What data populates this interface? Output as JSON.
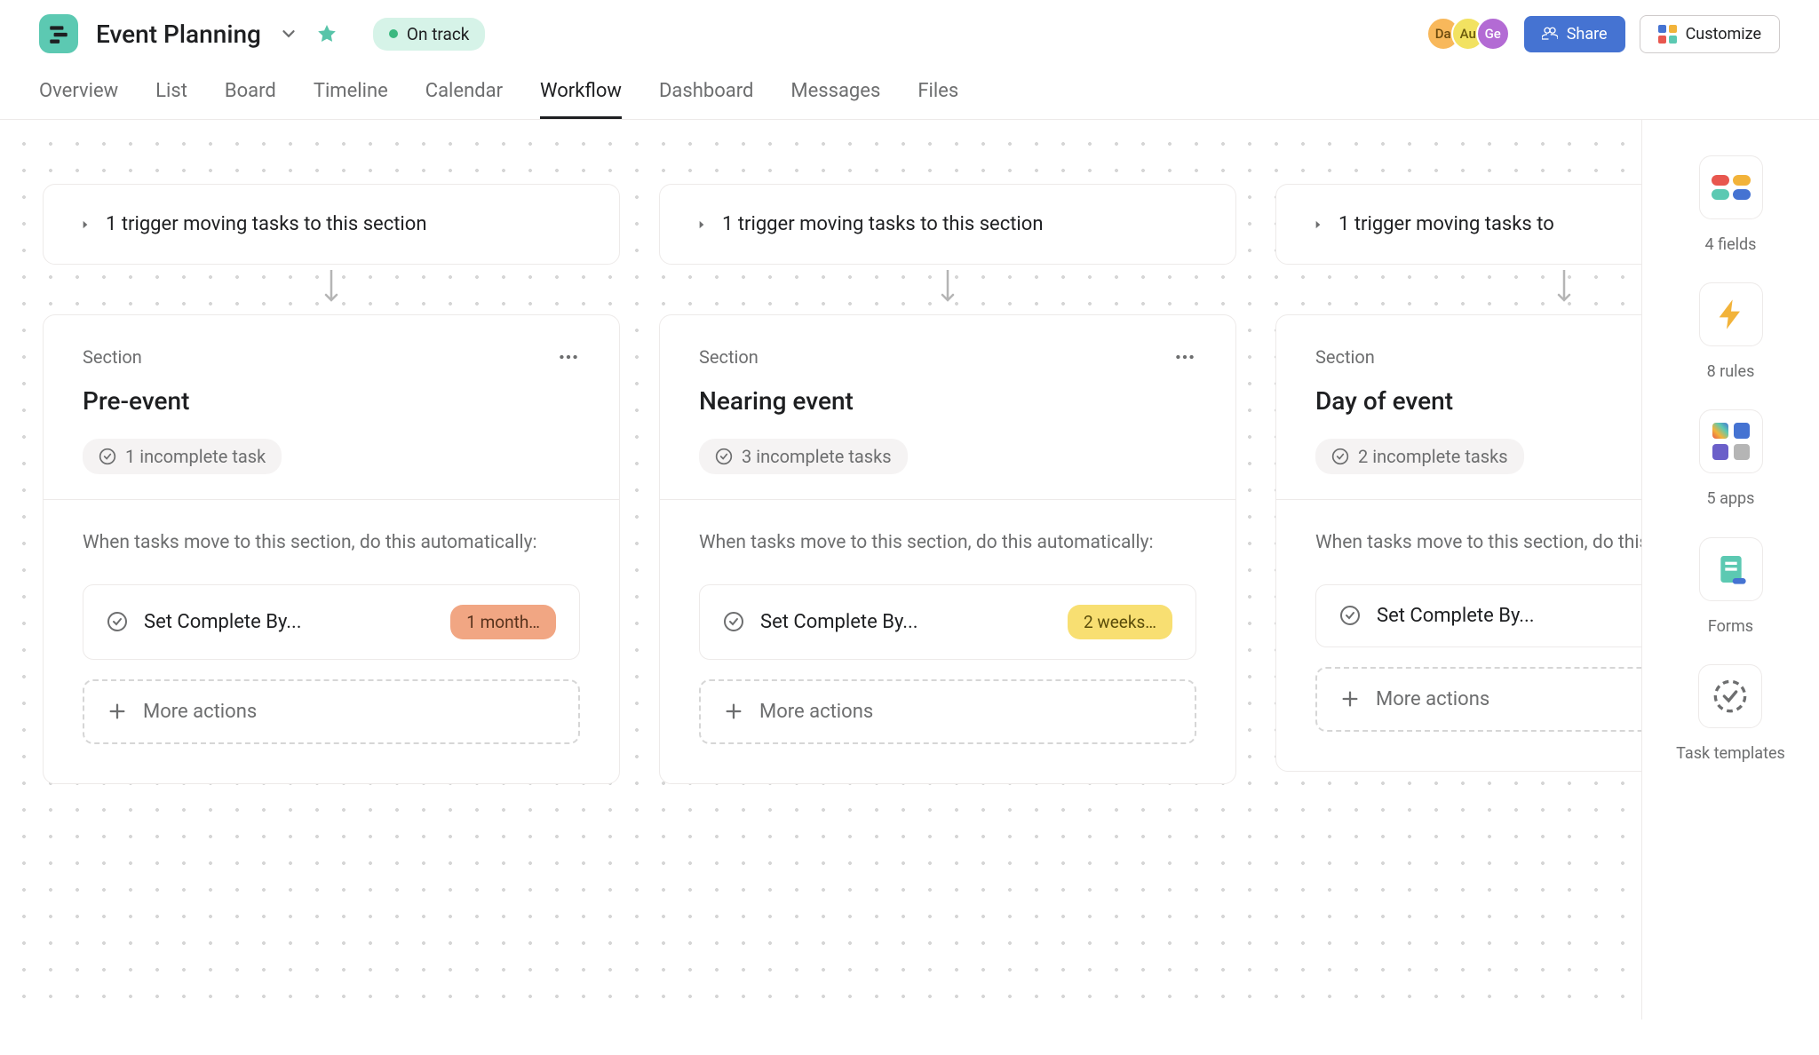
{
  "project": {
    "title": "Event Planning",
    "status": "On track"
  },
  "avatars": [
    {
      "initials": "Da",
      "bg": "#f8b85b",
      "fg": "#6b4a0d"
    },
    {
      "initials": "Au",
      "bg": "#f2e261",
      "fg": "#6b5b0d"
    },
    {
      "initials": "Ge",
      "bg": "#b36bd4",
      "fg": "#ffffff"
    }
  ],
  "buttons": {
    "share": "Share",
    "customize": "Customize"
  },
  "tabs": [
    "Overview",
    "List",
    "Board",
    "Timeline",
    "Calendar",
    "Workflow",
    "Dashboard",
    "Messages",
    "Files"
  ],
  "active_tab": "Workflow",
  "workflow": {
    "section_label": "Section",
    "automation_text": "When tasks move to this section, do this automatically:",
    "more_actions": "More actions",
    "columns": [
      {
        "trigger": "1 trigger moving tasks to this section",
        "title": "Pre-event",
        "tasks": "1 incomplete task",
        "rule": {
          "text": "Set Complete By...",
          "badge": "1 month…",
          "badge_class": "badge-orange"
        }
      },
      {
        "trigger": "1 trigger moving tasks to this section",
        "title": "Nearing event",
        "tasks": "3 incomplete tasks",
        "rule": {
          "text": "Set Complete By...",
          "badge": "2 weeks…",
          "badge_class": "badge-yellow"
        }
      },
      {
        "trigger": "1 trigger moving tasks to",
        "title": "Day of event",
        "tasks": "2 incomplete tasks",
        "rule": {
          "text": "Set Complete By...",
          "badge": "",
          "badge_class": ""
        }
      }
    ]
  },
  "sidebar": {
    "fields": "4 fields",
    "rules": "8 rules",
    "apps": "5 apps",
    "forms": "Forms",
    "templates": "Task templates"
  }
}
